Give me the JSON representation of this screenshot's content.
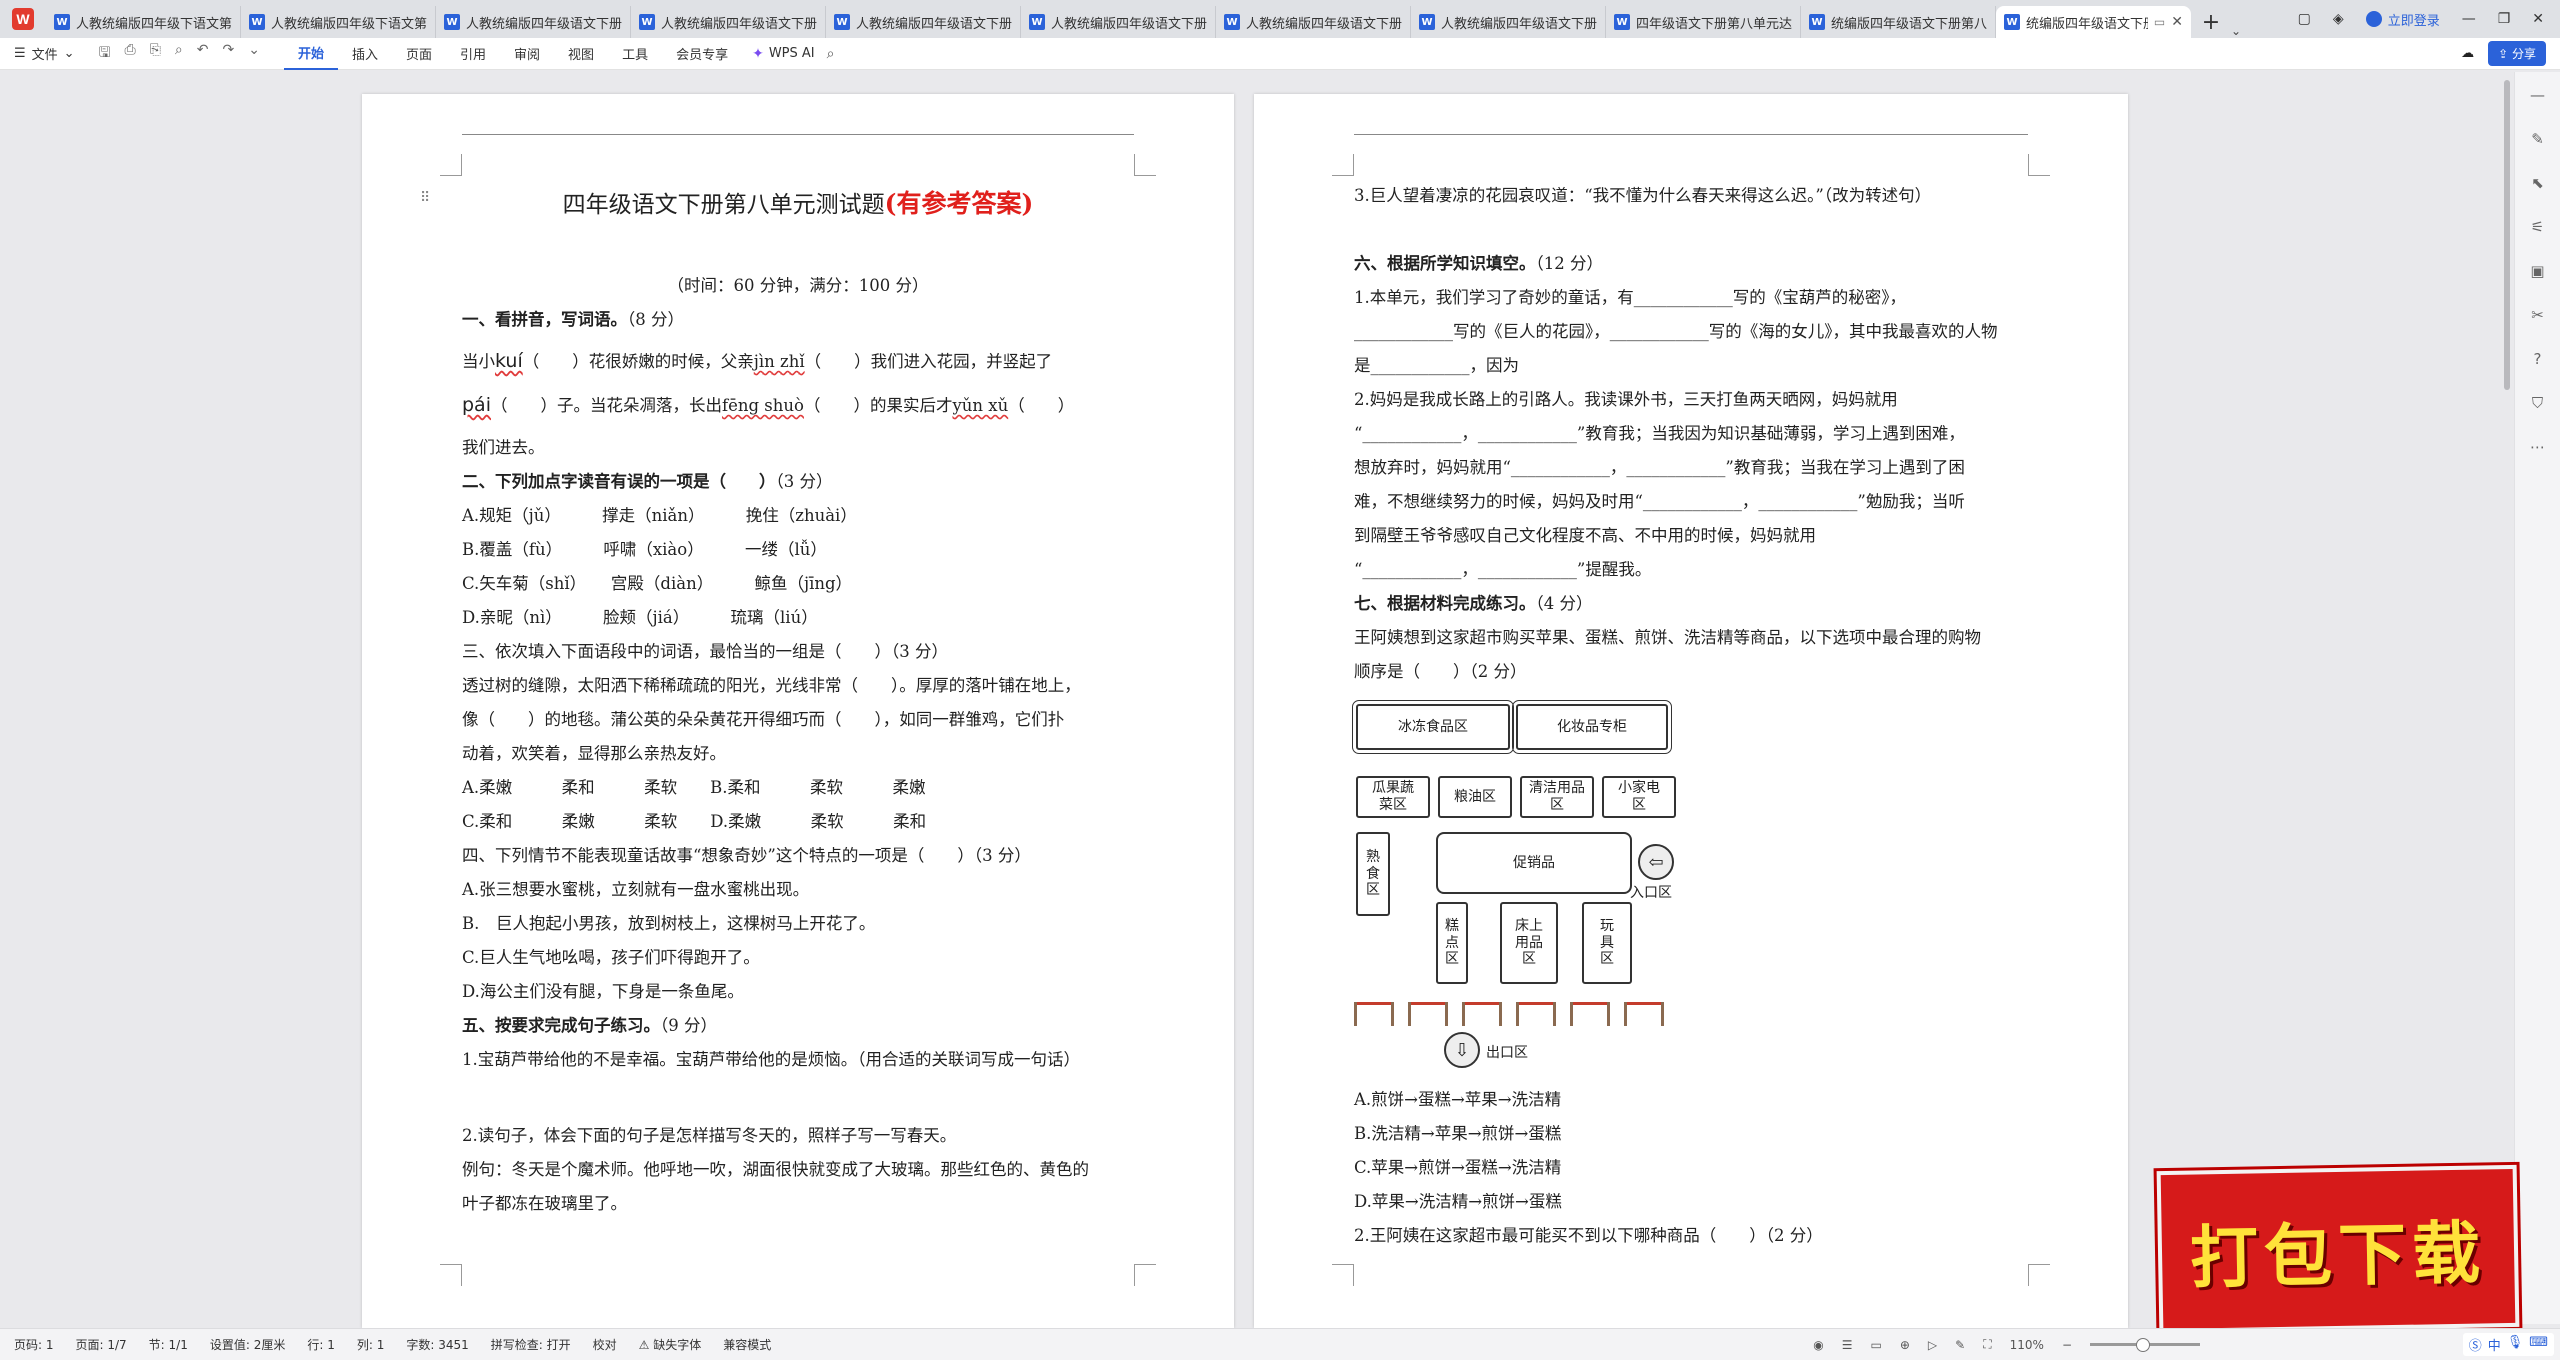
{
  "tabs": [
    {
      "label": "人教统编版四年级下语文第"
    },
    {
      "label": "人教统编版四年级下语文第八"
    },
    {
      "label": "人教统编版四年级语文下册"
    },
    {
      "label": "人教统编版四年级语文下册"
    },
    {
      "label": "人教统编版四年级语文下册"
    },
    {
      "label": "人教统编版四年级语文下册"
    },
    {
      "label": "人教统编版四年级语文下册"
    },
    {
      "label": "人教统编版四年级语文下册"
    },
    {
      "label": "四年级语文下册第八单元达"
    },
    {
      "label": "统编版四年级语文下册第八"
    },
    {
      "label": "统编版四年级语文下册",
      "active": true
    }
  ],
  "window": {
    "login": "立即登录"
  },
  "ribbon": {
    "file": "文件",
    "tabs": [
      "开始",
      "插入",
      "页面",
      "引用",
      "审阅",
      "视图",
      "工具",
      "会员专享"
    ],
    "wps_ai": "WPS AI",
    "share": "分享"
  },
  "left_page": {
    "title_main": "四年级语文下册第八单元测试题",
    "title_red": "(有参考答案)",
    "time_line": "（时间：60 分钟，满分：100 分）",
    "s1_head": "一、看拼音，写词语。",
    "s1_pts": "（8 分）",
    "s1_l1a": "当小",
    "s1_py1": "kuí",
    "s1_l1b": "（　　）花很娇嫩的时候，父亲",
    "s1_py2": "jìn zhǐ",
    "s1_l1c": "（　　）我们进入花园，并竖起了",
    "s1_py3": "pái",
    "s1_l2a": "（　　）子。当花朵凋落，长出",
    "s1_py4": "fēng shuò",
    "s1_l2b": "（　　）的果实后才",
    "s1_py5": "yǔn xǔ",
    "s1_l2c": "（　　）",
    "s1_l3": "我们进去。",
    "s2_head": "二、下列加点字读音有误的一项是（　　）",
    "s2_pts": "（3 分）",
    "s2_a": "A.规矩（jǔ）　　　撑走（niǎn）　　　挽住（zhuài）",
    "s2_b": "B.覆盖（fù）　　　呼啸（xiào）　　　一缕（lǚ）",
    "s2_c": "C.矢车菊（shǐ）　　宫殿（diàn）　　　鲸鱼（jīng）",
    "s2_d": "D.亲昵（nì）　　　脸颊（jiá）　　　琉璃（liú）",
    "s3_head": "三、依次填入下面语段中的词语，最恰当的一组是（　　）（3 分）",
    "s3_p1": "透过树的缝隙，太阳洒下稀稀疏疏的阳光，光线非常（　　）。厚厚的落叶铺在地上，",
    "s3_p2": "像（　　）的地毯。蒲公英的朵朵黄花开得细巧而（　　），如同一群雏鸡，它们扑",
    "s3_p3": "动着，欢笑着，显得那么亲热友好。",
    "s3_o1": "A.柔嫩　　　柔和　　　柔软　　B.柔和　　　柔软　　　柔嫩",
    "s3_o2": "C.柔和　　　柔嫩　　　柔软　　D.柔嫩　　　柔软　　　柔和",
    "s4_head": "四、下列情节不能表现童话故事“想象奇妙”这个特点的一项是（　　）（3 分）",
    "s4_a": "A.张三想要水蜜桃，立刻就有一盘水蜜桃出现。",
    "s4_b": "B.　巨人抱起小男孩，放到树枝上，这棵树马上开花了。",
    "s4_c": "C.巨人生气地吆喝，孩子们吓得跑开了。",
    "s4_d": "D.海公主们没有腿，下身是一条鱼尾。",
    "s5_head": "五、按要求完成句子练习。",
    "s5_pts": "（9 分）",
    "s5_q1": "1.宝葫芦带给他的不是幸福。宝葫芦带给他的是烦恼。（用合适的关联词写成一句话）",
    "s5_q2": "2.读句子，体会下面的句子是怎样描写冬天的，照样子写一写春天。",
    "s5_ex1": "例句：冬天是个魔术师。他呼地一吹，湖面很快就变成了大玻璃。那些红色的、黄色的",
    "s5_ex2": "叶子都冻在玻璃里了。"
  },
  "right_page": {
    "q3": "3.巨人望着凄凉的花园哀叹道：“我不懂为什么春天来得这么迟。”（改为转述句）",
    "s6_head": "六、根据所学知识填空。",
    "s6_pts": "（12 分）",
    "s6_1a": "1.本单元，我们学习了奇妙的童话，有____________写的《宝葫芦的秘密》，",
    "s6_1b": "____________写的《巨人的花园》，____________写的《海的女儿》，其中我最喜欢的人物",
    "s6_1c": "是____________，因为",
    "s6_2a": "2.妈妈是我成长路上的引路人。我读课外书，三天打鱼两天晒网，妈妈就用",
    "s6_2b": "“____________，____________”教育我；当我因为知识基础薄弱，学习上遇到困难，",
    "s6_2c": "想放弃时，妈妈就用“____________，____________”教育我；当我在学习上遇到了困",
    "s6_2d": "难，不想继续努力的时候，妈妈及时用“____________，____________”勉励我；当听",
    "s6_2e": "到隔壁王爷爷感叹自己文化程度不高、不中用的时候，妈妈就用",
    "s6_2f": "“____________，____________”提醒我。",
    "s7_head": "七、根据材料完成练习。",
    "s7_pts": "（4 分）",
    "s7_p1": "王阿姨想到这家超市购买苹果、蛋糕、煎饼、洗洁精等商品，以下选项中最合理的购物",
    "s7_p2": "顺序是（　　）（2 分）",
    "map": {
      "frozen": "冰冻食品区",
      "cosmetics": "化妆品专柜",
      "fruit": "瓜果蔬菜区",
      "grain": "粮油区",
      "cleaning": "清洁用品区",
      "appliance": "小家电区",
      "cooked": "熟食区",
      "promo": "促销品",
      "entrance": "入口区",
      "cake": "糕点区",
      "bedding": "床上用品区",
      "toys": "玩具区",
      "exit": "出口区"
    },
    "opt_a": "A.煎饼→蛋糕→苹果→洗洁精",
    "opt_b": "B.洗洁精→苹果→煎饼→蛋糕",
    "opt_c": "C.苹果→煎饼→蛋糕→洗洁精",
    "opt_d": "D.苹果→洗洁精→煎饼→蛋糕",
    "q2": "2.王阿姨在这家超市最可能买不到以下哪种商品（　　）（2 分）"
  },
  "statusbar": {
    "page": "页码: 1",
    "pages": "页面: 1/7",
    "section": "节: 1/1",
    "setting": "设置值: 2厘米",
    "row": "行: 1",
    "col": "列: 1",
    "words": "字数: 3451",
    "spell": "拼写检查: 打开",
    "proof": "校对",
    "missing_font": "缺失字体",
    "compat": "兼容模式",
    "zoom": "110%"
  },
  "banner": {
    "text": "打包下载"
  },
  "ime": {
    "label": "中"
  }
}
